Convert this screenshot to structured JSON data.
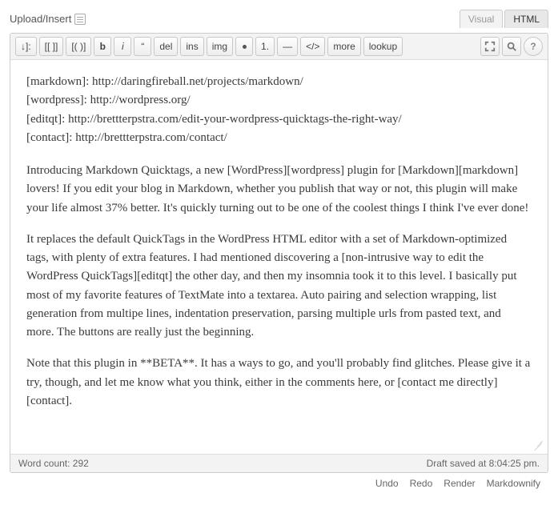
{
  "header": {
    "upload_label": "Upload/Insert"
  },
  "tabs": {
    "visual": "Visual",
    "html": "HTML"
  },
  "toolbar": {
    "downarrow": "↓]:",
    "brackets1": "[[ ]]",
    "brackets2": "[( )]",
    "bold": "b",
    "italic": "i",
    "quote": "“",
    "del": "del",
    "ins": "ins",
    "img": "img",
    "bullet": "•",
    "numlist": "1.",
    "hr": "—",
    "code": "</>",
    "more": "more",
    "lookup": "lookup"
  },
  "content": {
    "ref1": "[markdown]: http://daringfireball.net/projects/markdown/",
    "ref2": "[wordpress]: http://wordpress.org/",
    "ref3": "[editqt]: http://brettterpstra.com/edit-your-wordpress-quicktags-the-right-way/",
    "ref4": "[contact]: http://brettterpstra.com/contact/",
    "p1": "Introducing Markdown Quicktags, a new [WordPress][wordpress] plugin for [Markdown][markdown] lovers! If you edit your blog in Markdown, whether you publish that way or not, this plugin will make your life almost 37% better. It's quickly turning out to be one of the coolest things I think I've ever done!",
    "p2": "It replaces the default QuickTags in the WordPress HTML editor with a set of Markdown-optimized tags, with plenty of extra features. I had mentioned discovering a [non-intrusive way to edit the WordPress QuickTags][editqt] the other day, and then my insomnia took it to this level. I basically put most of my favorite features of TextMate into a textarea. Auto pairing and selection wrapping, list generation from multipe lines, indentation preservation, parsing multiple urls from pasted text, and more. The buttons are really just the beginning.",
    "p3": "Note that this plugin in **BETA**. It has a ways to go, and you'll probably find glitches. Please give it a try, though, and let me know what you think, either in the comments here, or [contact me directly][contact]."
  },
  "status": {
    "word_count": "Word count: 292",
    "draft_saved": "Draft saved at 8:04:25 pm."
  },
  "actions": {
    "undo": "Undo",
    "redo": "Redo",
    "render": "Render",
    "markdownify": "Markdownify"
  }
}
